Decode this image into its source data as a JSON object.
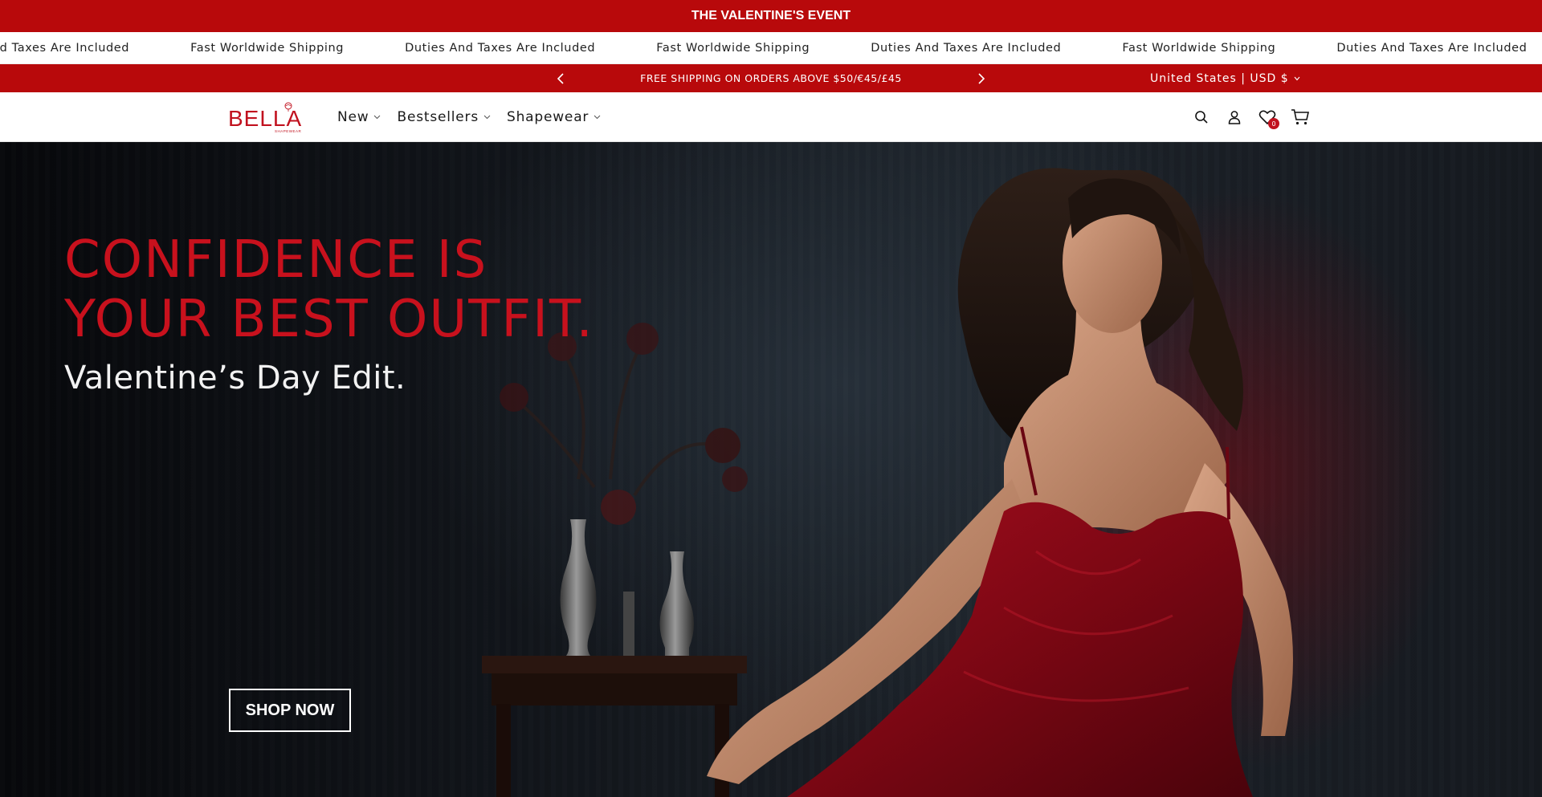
{
  "event_bar": {
    "text": "THE VALENTINE'S EVENT"
  },
  "marquee": {
    "items": [
      "Duties And Taxes Are Included",
      "Fast Worldwide Shipping",
      "Duties And Taxes Are Included",
      "Fast Worldwide Shipping",
      "Duties And Taxes Are Included",
      "Fast Worldwide Shipping",
      "Duties And Taxes Are Included"
    ]
  },
  "announcement": {
    "text": "FREE SHIPPING ON ORDERS ABOVE $50/€45/£45",
    "prev_icon": "chevron-left-icon",
    "next_icon": "chevron-right-icon"
  },
  "currency": {
    "label": "United States | USD $"
  },
  "header": {
    "logo": {
      "text": "BELLA",
      "sub": "SHAPEWEAR"
    },
    "nav": [
      {
        "label": "New"
      },
      {
        "label": "Bestsellers"
      },
      {
        "label": "Shapewear"
      }
    ],
    "icons": [
      "search-icon",
      "account-icon",
      "wishlist-icon",
      "cart-icon"
    ],
    "wishlist_count": "0"
  },
  "hero": {
    "title_line1": "CONFIDENCE IS",
    "title_line2": "YOUR BEST OUTFIT.",
    "subtitle": "Valentine’s Day Edit.",
    "cta_label": "SHOP NOW"
  },
  "colors": {
    "brand_red": "#b8090b",
    "title_red": "#c8111d",
    "hero_dark": "#13171d"
  }
}
